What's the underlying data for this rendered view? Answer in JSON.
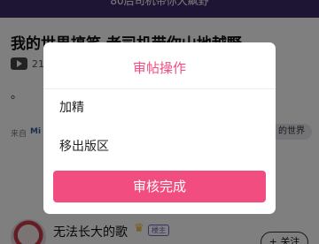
{
  "topbar": {
    "text": "80后司机带你大飙野"
  },
  "post": {
    "title": "我的世界搞笑 老司机带你山地越野",
    "video_count": "21",
    "body": "。",
    "meta_prefix": "来自",
    "meta_user": "Mi",
    "tag": "的世界"
  },
  "author": {
    "name": "无法长大的歌",
    "crown": "♛",
    "badge": "楼主",
    "follow_label": "+ 关注"
  },
  "dialog": {
    "title": "审帖操作",
    "options": [
      "加精",
      "移出版区"
    ],
    "confirm_label": "审核完成",
    "accent_color": "#f24d80"
  }
}
